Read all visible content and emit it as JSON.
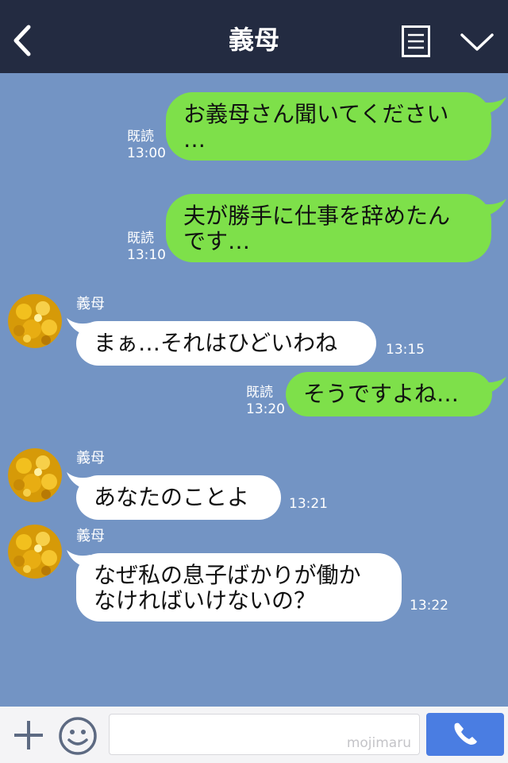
{
  "header": {
    "title": "義母",
    "back_icon": "back-chevron-icon",
    "menu_icon": "menu-list-icon",
    "expand_icon": "chevron-down-icon"
  },
  "messages": [
    {
      "from": "me",
      "lines": [
        "お義母さん聞いてください",
        "…"
      ],
      "read": "既読",
      "time": "13:00"
    },
    {
      "from": "me",
      "lines": [
        "夫が勝手に仕事を辞めたん",
        "です…"
      ],
      "read": "既読",
      "time": "13:10"
    },
    {
      "from": "them",
      "sender": "義母",
      "lines": [
        "まぁ…それはひどいわね"
      ],
      "time": "13:15"
    },
    {
      "from": "me",
      "lines": [
        "そうですよね…"
      ],
      "read": "既読",
      "time": "13:20"
    },
    {
      "from": "them",
      "sender": "義母",
      "lines": [
        "あなたのことよ"
      ],
      "time": "13:21"
    },
    {
      "from": "them",
      "sender": "義母",
      "lines": [
        "なぜ私の息子ばかりが働か",
        "なければいけないの？"
      ],
      "time": "13:22"
    }
  ],
  "footer": {
    "input_placeholder": "",
    "watermark": "mojimaru",
    "plus_icon": "plus-icon",
    "emoji_icon": "smiley-icon",
    "call_icon": "phone-icon"
  },
  "colors": {
    "header_bg": "#232b41",
    "chat_bg": "#7394c4",
    "outgoing_bubble": "#7ee04a",
    "incoming_bubble": "#ffffff",
    "call_button": "#4a7de2"
  }
}
